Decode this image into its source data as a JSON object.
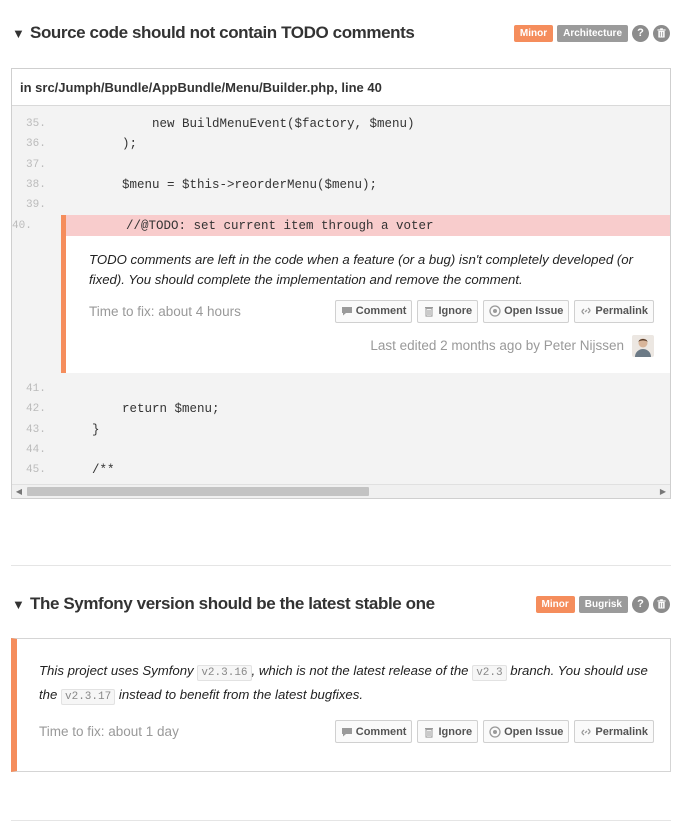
{
  "issue1": {
    "title": "Source code should not contain TODO comments",
    "severity": "Minor",
    "category": "Architecture",
    "help": "?",
    "file_path": "in src/Jumph/Bundle/AppBundle/Menu/Builder.php, line 40",
    "lines_before": [
      {
        "num": "35.",
        "text": "            new BuildMenuEvent($factory, $menu)"
      },
      {
        "num": "36.",
        "text": "        );"
      },
      {
        "num": "37.",
        "text": ""
      },
      {
        "num": "38.",
        "text": "        $menu = $this->reorderMenu($menu);"
      },
      {
        "num": "39.",
        "text": ""
      }
    ],
    "highlight_line": {
      "num": "40.",
      "text": "        //@TODO: set current item through a voter"
    },
    "comment": "TODO comments are left in the code when a feature (or a bug) isn't completely developed (or fixed). You should complete the implementation and remove the comment.",
    "time_to_fix": "Time to fix: about 4 hours",
    "edited": "Last edited 2 months ago by Peter Nijssen",
    "lines_after": [
      {
        "num": "41.",
        "text": ""
      },
      {
        "num": "42.",
        "text": "        return $menu;"
      },
      {
        "num": "43.",
        "text": "    }"
      },
      {
        "num": "44.",
        "text": ""
      },
      {
        "num": "45.",
        "text": "    /**"
      }
    ]
  },
  "issue2": {
    "title": "The Symfony version should be the latest stable one",
    "severity": "Minor",
    "category": "Bugrisk",
    "help": "?",
    "msg_part1": "This project uses Symfony ",
    "code1": "v2.3.16",
    "msg_part2": ", which is not the latest release of the ",
    "code2": "v2.3",
    "msg_part3": " branch. You should use the ",
    "code3": "v2.3.17",
    "msg_part4": " instead to benefit from the latest bugfixes.",
    "time_to_fix": "Time to fix: about 1 day"
  },
  "actions": {
    "comment": "Comment",
    "ignore": "Ignore",
    "open_issue": "Open Issue",
    "permalink": "Permalink"
  },
  "scroll": {
    "left": "◀",
    "right": "▶"
  },
  "colors": {
    "accent": "#f58d5c",
    "highlight": "#f8cccc",
    "badge_grey": "#9b9b9b"
  }
}
